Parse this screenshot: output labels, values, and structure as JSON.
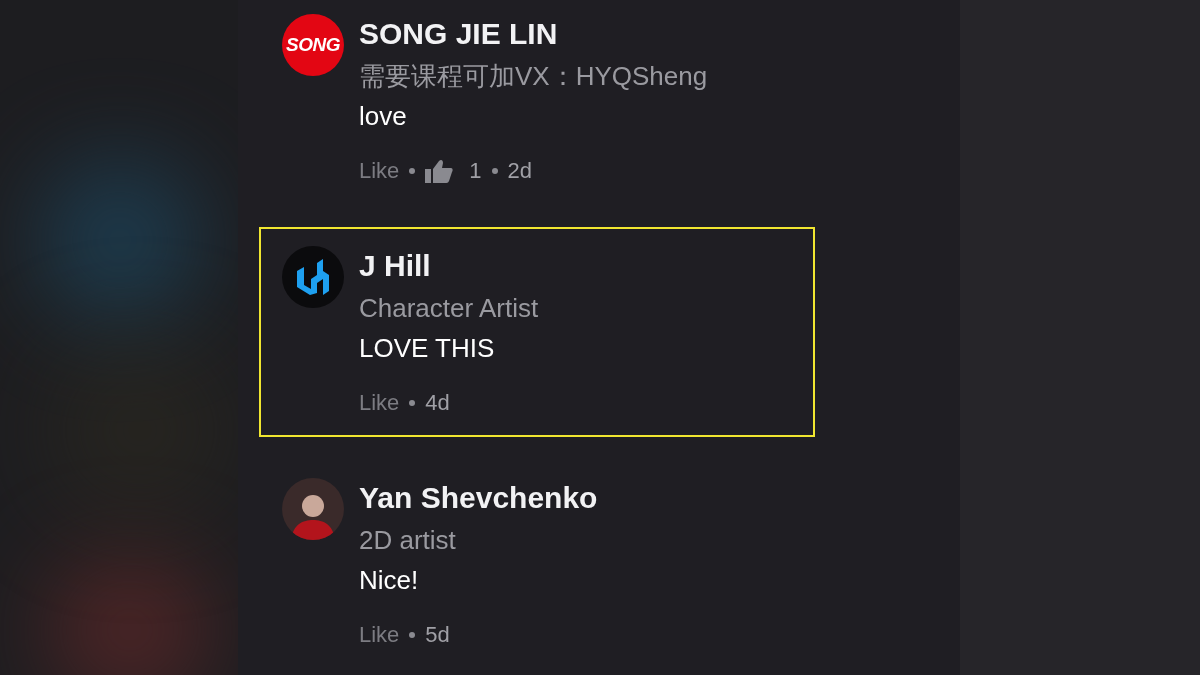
{
  "comments": [
    {
      "author": "SONG JIE LIN",
      "avatar": {
        "kind": "text",
        "text": "SONG"
      },
      "headline": "需要课程可加VX：HYQSheng",
      "body": "love",
      "like_label": "Like",
      "likes": "1",
      "time": "2d",
      "highlighted": false
    },
    {
      "author": "J Hill",
      "avatar": {
        "kind": "logo"
      },
      "headline": "Character Artist",
      "body": "LOVE THIS",
      "like_label": "Like",
      "time": "4d",
      "highlighted": true
    },
    {
      "author": "Yan Shevchenko",
      "avatar": {
        "kind": "photo"
      },
      "headline": "2D artist",
      "body": "Nice!",
      "like_label": "Like",
      "time": "5d",
      "highlighted": false
    }
  ]
}
